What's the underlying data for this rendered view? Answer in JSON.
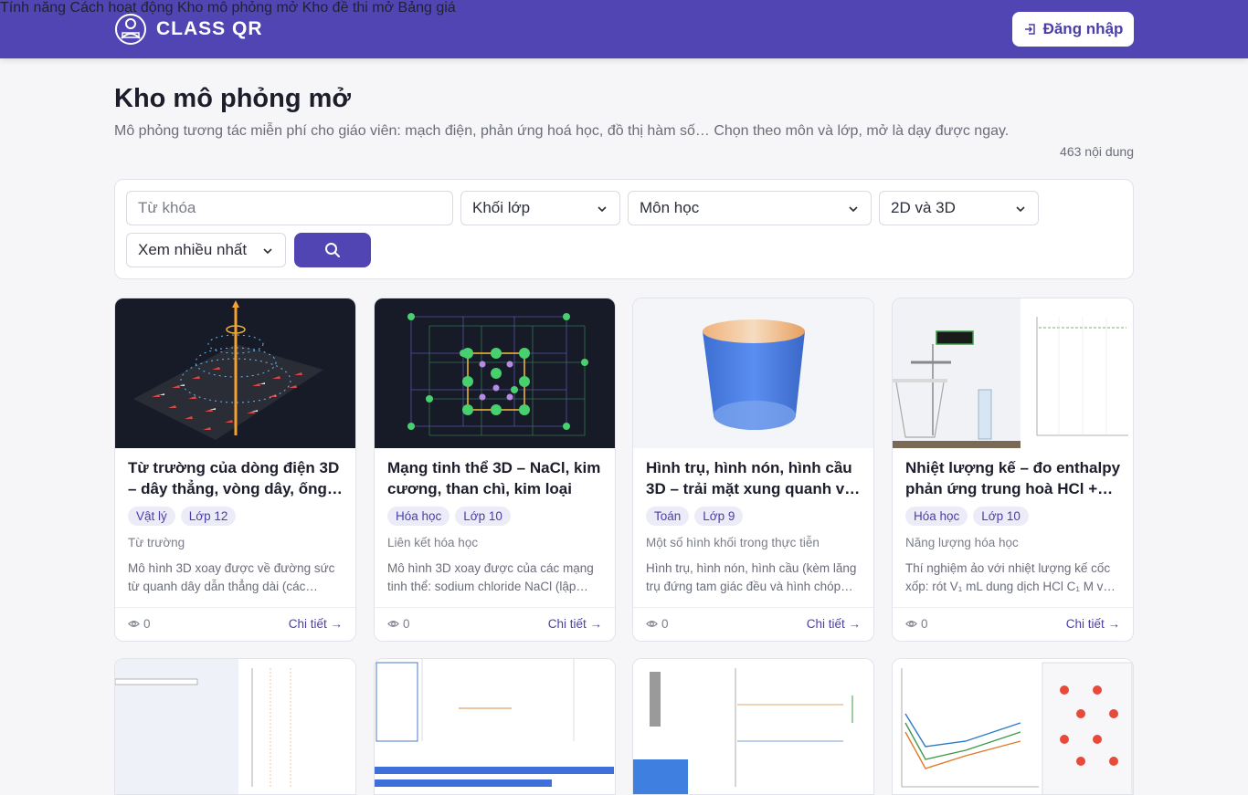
{
  "header": {
    "brand": "CLASS QR",
    "nav": [
      "Tính năng",
      "Cách hoạt động",
      "Kho mô phỏng mở",
      "Kho đề thi mở",
      "Bảng giá"
    ],
    "login": "Đăng nhập"
  },
  "page": {
    "title": "Kho mô phỏng mở",
    "description": "Mô phỏng tương tác miễn phí cho giáo viên: mạch điện, phản ứng hoá học, đồ thị hàm số… Chọn theo môn và lớp, mở là dạy được ngay.",
    "count": "463 nội dung"
  },
  "filters": {
    "keyword_placeholder": "Từ khóa",
    "grade": "Khối lớp",
    "subject": "Môn học",
    "dimension": "2D và 3D",
    "sort": "Xem nhiều nhất"
  },
  "cards": [
    {
      "title": "Từ trường của dòng điện 3D – dây thẳng, vòng dây, ống…",
      "subject": "Vật lý",
      "grade": "Lớp 12",
      "topic": "Từ trường",
      "desc": "Mô hình 3D xoay được về đường sức từ quanh dây dẫn thẳng dài (các…",
      "views": "0",
      "detail": "Chi tiết →"
    },
    {
      "title": "Mạng tinh thể 3D – NaCl, kim cương, than chì, kim loại",
      "subject": "Hóa học",
      "grade": "Lớp 10",
      "topic": "Liên kết hóa học",
      "desc": "Mô hình 3D xoay được của các mạng tinh thể: sodium chloride NaCl (lập…",
      "views": "0",
      "detail": "Chi tiết →"
    },
    {
      "title": "Hình trụ, hình nón, hình cầu 3D – trải mặt xung quanh v…",
      "subject": "Toán",
      "grade": "Lớp 9",
      "topic": "Một số hình khối trong thực tiễn",
      "desc": "Hình trụ, hình nón, hình cầu (kèm lăng trụ đứng tam giác đều và hình chóp…",
      "views": "0",
      "detail": "Chi tiết →"
    },
    {
      "title": "Nhiệt lượng kế – đo enthalpy phản ứng trung hoà HCl +…",
      "subject": "Hóa học",
      "grade": "Lớp 10",
      "topic": "Năng lượng hóa học",
      "desc": "Thí nghiệm ảo với nhiệt lượng kế cốc xốp: rót V₁ mL dung dịch HCl C₁ M v…",
      "views": "0",
      "detail": "Chi tiết →"
    }
  ],
  "colors": {
    "primary": "#5145b4",
    "accent_text": "#4a3fa6",
    "tag_bg": "#ecebf8"
  }
}
